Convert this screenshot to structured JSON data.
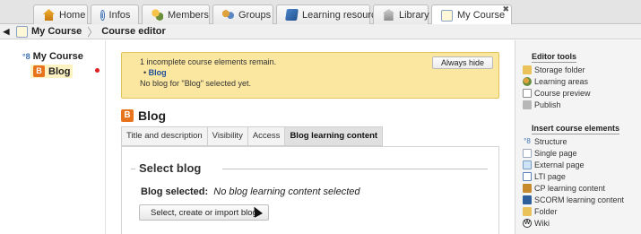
{
  "top_tabs": [
    {
      "label": "Home",
      "icon": "home-icon"
    },
    {
      "label": "Infos",
      "icon": "info-icon"
    },
    {
      "label": "Members",
      "icon": "members-icon"
    },
    {
      "label": "Groups",
      "icon": "groups-icon"
    },
    {
      "label": "Learning resources",
      "icon": "learning-resources-icon"
    },
    {
      "label": "Library",
      "icon": "library-icon"
    },
    {
      "label": "My Course",
      "icon": "course-icon",
      "active": true,
      "close_glyph": "✖"
    }
  ],
  "breadcrumb": {
    "back_glyph": "◀",
    "items": [
      "My Course",
      "Course editor"
    ],
    "separator": "〉"
  },
  "tree": {
    "root": {
      "label": "My Course",
      "icon_glyph": "°8"
    },
    "node": {
      "label": "Blog",
      "icon_glyph": "B"
    }
  },
  "warning": {
    "line1": "1 incomplete course elements remain.",
    "bullet": "Blog",
    "line3": "No blog for \"Blog\" selected yet.",
    "hide_button": "Always hide",
    "color": "#fbe7a0"
  },
  "node_title": {
    "label": "Blog",
    "icon_glyph": "B"
  },
  "editor_tabs": [
    {
      "label": "Title and description"
    },
    {
      "label": "Visibility"
    },
    {
      "label": "Access"
    },
    {
      "label": "Blog learning content",
      "active": true
    }
  ],
  "select_blog": {
    "legend": "Select blog",
    "selected_label": "Blog selected:",
    "selected_value": "No blog learning content selected",
    "button": "Select, create or import blog"
  },
  "sidebar": {
    "tools_heading": "Editor tools",
    "tools": [
      {
        "label": "Storage folder",
        "icon": "storage-folder-icon"
      },
      {
        "label": "Learning areas",
        "icon": "learning-areas-icon"
      },
      {
        "label": "Course preview",
        "icon": "course-preview-icon"
      },
      {
        "label": "Publish",
        "icon": "publish-icon"
      }
    ],
    "insert_heading": "Insert course elements",
    "insert": [
      {
        "label": "Structure",
        "icon": "structure-icon"
      },
      {
        "label": "Single page",
        "icon": "single-page-icon"
      },
      {
        "label": "External page",
        "icon": "external-page-icon"
      },
      {
        "label": "LTI page",
        "icon": "lti-page-icon"
      },
      {
        "label": "CP learning content",
        "icon": "cp-content-icon"
      },
      {
        "label": "SCORM learning content",
        "icon": "scorm-content-icon"
      },
      {
        "label": "Folder",
        "icon": "folder-icon"
      },
      {
        "label": "Wiki",
        "icon": "wiki-icon"
      }
    ]
  },
  "colors": {
    "blog_orange": "#e8731d",
    "link_blue": "#1d4f9a",
    "node_highlight": "#fdf2c2"
  }
}
